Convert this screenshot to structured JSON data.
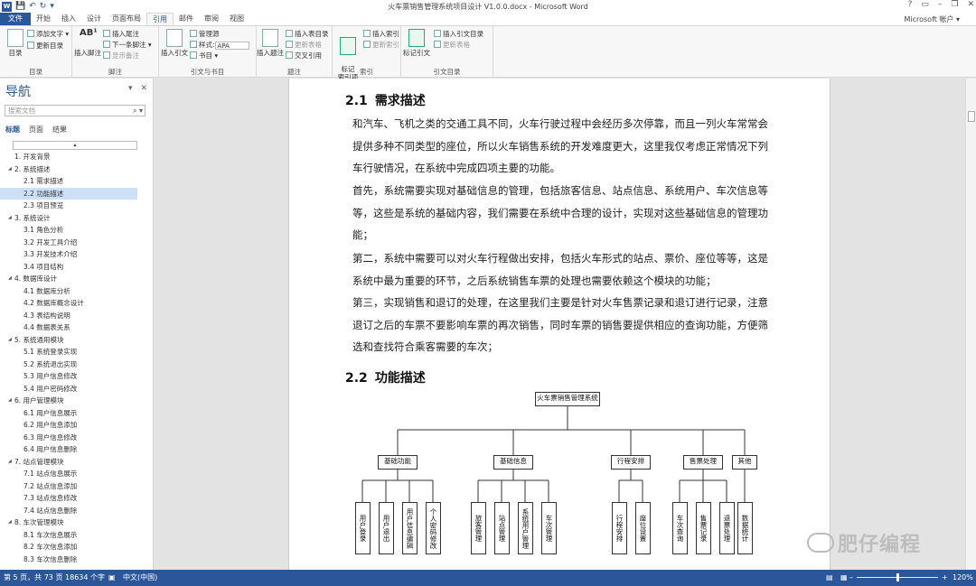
{
  "window": {
    "title": "火车票销售管理系统项目设计 V1.0.0.docx - Microsoft Word",
    "controls": [
      "?",
      "▭",
      "–",
      "❐",
      "✕"
    ]
  },
  "qat": {
    "app_icon": "W",
    "save": "💾",
    "undo": "↶",
    "redo": "↻",
    "more": "▾"
  },
  "tabs": [
    {
      "label": "文件"
    },
    {
      "label": "开始"
    },
    {
      "label": "插入"
    },
    {
      "label": "设计"
    },
    {
      "label": "页面布局"
    },
    {
      "label": "引用"
    },
    {
      "label": "邮件"
    },
    {
      "label": "审阅"
    },
    {
      "label": "视图"
    }
  ],
  "account": "Microsoft 帐户 ▾",
  "ribbon": {
    "toc": {
      "big": "目录",
      "add_text": "添加文字 ▾",
      "update": "更新目录",
      "group": "目录"
    },
    "footnote": {
      "big": "插入脚注",
      "insert_endnote": "插入尾注",
      "next_footnote": "下一条脚注 ▾",
      "show_notes": "显示备注",
      "group": "脚注",
      "ab_label": "AB¹"
    },
    "citation": {
      "big": "插入引文",
      "manage": "管理源",
      "style_label": "样式:",
      "style_value": "APA",
      "bib": "书目 ▾",
      "group": "引文与书目"
    },
    "caption": {
      "big": "插入题注",
      "insert_tof": "插入表目录",
      "update_table": "更新表格",
      "crossref": "交叉引用",
      "group": "题注"
    },
    "index": {
      "big": "标记\n索引项",
      "insert_index": "插入索引",
      "update_index": "更新索引",
      "group": "索引"
    },
    "toa": {
      "big": "标记引文",
      "insert_toa": "插入引文目录",
      "update_table": "更新表格",
      "group": "引文目录"
    }
  },
  "nav": {
    "title": "导航",
    "search_placeholder": "搜索文档",
    "tabs": [
      "标题",
      "页面",
      "结果"
    ],
    "items": [
      {
        "level": 1,
        "text": "1. 开发背景"
      },
      {
        "level": 1,
        "text": "2. 系统描述",
        "expanded": true
      },
      {
        "level": 2,
        "text": "2.1 需求描述"
      },
      {
        "level": 2,
        "text": "2.2 功能描述",
        "selected": true
      },
      {
        "level": 2,
        "text": "2.3 项目预览"
      },
      {
        "level": 1,
        "text": "3. 系统设计",
        "expanded": true
      },
      {
        "level": 2,
        "text": "3.1 角色分析"
      },
      {
        "level": 2,
        "text": "3.2 开发工具介绍"
      },
      {
        "level": 2,
        "text": "3.3 开发技术介绍"
      },
      {
        "level": 2,
        "text": "3.4 项目结构"
      },
      {
        "level": 1,
        "text": "4. 数据库设计",
        "expanded": true
      },
      {
        "level": 2,
        "text": "4.1 数据库分析"
      },
      {
        "level": 2,
        "text": "4.2 数据库概念设计"
      },
      {
        "level": 2,
        "text": "4.3 表结构说明"
      },
      {
        "level": 2,
        "text": "4.4 数据表关系"
      },
      {
        "level": 1,
        "text": "5. 系统通用模块",
        "expanded": true
      },
      {
        "level": 2,
        "text": "5.1 系统登录实现"
      },
      {
        "level": 2,
        "text": "5.2 系统退出实现"
      },
      {
        "level": 2,
        "text": "5.3 用户信息修改"
      },
      {
        "level": 2,
        "text": "5.4 用户密码修改"
      },
      {
        "level": 1,
        "text": "6. 用户管理模块",
        "expanded": true
      },
      {
        "level": 2,
        "text": "6.1 用户信息展示"
      },
      {
        "level": 2,
        "text": "6.2 用户信息添加"
      },
      {
        "level": 2,
        "text": "6.3 用户信息修改"
      },
      {
        "level": 2,
        "text": "6.4 用户信息删除"
      },
      {
        "level": 1,
        "text": "7. 站点管理模块",
        "expanded": true
      },
      {
        "level": 2,
        "text": "7.1 站点信息展示"
      },
      {
        "level": 2,
        "text": "7.2 站点信息添加"
      },
      {
        "level": 2,
        "text": "7.3 站点信息修改"
      },
      {
        "level": 2,
        "text": "7.4 站点信息删除"
      },
      {
        "level": 1,
        "text": "8. 车次管理模块",
        "expanded": true
      },
      {
        "level": 2,
        "text": "8.1 车次信息展示"
      },
      {
        "level": 2,
        "text": "8.2 车次信息添加"
      },
      {
        "level": 2,
        "text": "8.3 车次信息删除"
      }
    ]
  },
  "document": {
    "h1": {
      "num": "2.1",
      "text": "需求描述"
    },
    "p1": "和汽车、飞机之类的交通工具不同，火车行驶过程中会经历多次停靠，而且一列火车常常会提供多种不同类型的座位，所以火车销售系统的开发难度更大，这里我仅考虑正常情况下列车行驶情况，在系统中完成四项主要的功能。",
    "p2": "首先，系统需要实现对基础信息的管理，包括旅客信息、站点信息、系统用户、车次信息等等，这些是系统的基础内容，我们需要在系统中合理的设计，实现对这些基础信息的管理功能；",
    "p3": "第二，系统中需要可以对火车行程做出安排，包括火车形式的站点、票价、座位等等，这是系统中最为重要的环节，之后系统销售车票的处理也需要依赖这个模块的功能；",
    "p4": "第三，实现销售和退订的处理，在这里我们主要是针对火车售票记录和退订进行记录，注意退订之后的车票不要影响车票的再次销售，同时车票的销售要提供相应的查询功能，方便筛选和查找符合乘客需要的车次；",
    "h2": {
      "num": "2.2",
      "text": "功能描述"
    },
    "chart": {
      "root": "火车票销售管理系统",
      "modules": [
        {
          "name": "基础功能",
          "children": [
            "用户登录",
            "用户退出",
            "用户信息编辑",
            "个人密码修改"
          ]
        },
        {
          "name": "基础信息",
          "children": [
            "旅客管理",
            "站点管理",
            "系统用户管理",
            "车次管理"
          ]
        },
        {
          "name": "行程安排",
          "children": [
            "行程安排",
            "座位设置"
          ]
        },
        {
          "name": "售票处理",
          "children": [
            "车次查询",
            "售票记录",
            "退票处理"
          ]
        },
        {
          "name": "其他",
          "children": [
            "数据统计"
          ]
        }
      ]
    },
    "watermark": "肥仔编程"
  },
  "status": {
    "page": "第 5 页，共 73 页",
    "words": "18634 个字",
    "lang": "中文(中国)",
    "zoom": "120%"
  }
}
